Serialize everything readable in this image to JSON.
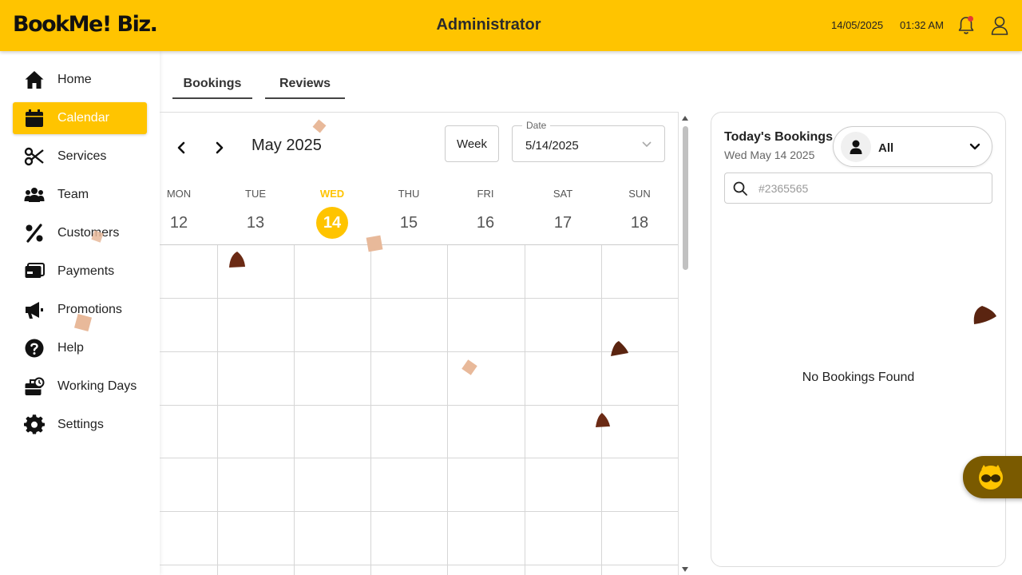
{
  "app": {
    "logo_text": "BookMe! Biz.",
    "title": "Administrator",
    "date": "14/05/2025",
    "time": "01:32 AM",
    "colors": {
      "brand": "#FFC400",
      "notification_dot": "#e53935"
    }
  },
  "sidebar": {
    "items": [
      {
        "label": "Home",
        "icon": "home-icon"
      },
      {
        "label": "Calendar",
        "icon": "calendar-icon",
        "active": true
      },
      {
        "label": "Services",
        "icon": "scissors-icon"
      },
      {
        "label": "Team",
        "icon": "team-icon"
      },
      {
        "label": "Customers",
        "icon": "percent-icon"
      },
      {
        "label": "Payments",
        "icon": "payments-icon"
      },
      {
        "label": "Promotions",
        "icon": "megaphone-icon"
      },
      {
        "label": "Help",
        "icon": "help-icon"
      },
      {
        "label": "Working Days",
        "icon": "working-days-icon"
      },
      {
        "label": "Settings",
        "icon": "gear-icon"
      }
    ]
  },
  "tabs": [
    {
      "label": "Bookings"
    },
    {
      "label": "Reviews"
    }
  ],
  "calendar": {
    "month_label": "May 2025",
    "view_button": "Week",
    "date_field": {
      "label": "Date",
      "value": "5/14/2025"
    },
    "days": [
      {
        "name": "MON",
        "num": "12"
      },
      {
        "name": "TUE",
        "num": "13"
      },
      {
        "name": "WED",
        "num": "14",
        "today": true
      },
      {
        "name": "THU",
        "num": "15"
      },
      {
        "name": "FRI",
        "num": "16"
      },
      {
        "name": "SAT",
        "num": "17"
      },
      {
        "name": "SUN",
        "num": "18"
      }
    ]
  },
  "todays_bookings": {
    "title": "Today's Bookings",
    "subtitle": "Wed May 14 2025",
    "staff_filter": "All",
    "search_placeholder": "#2365565",
    "empty_message": "No Bookings Found"
  }
}
